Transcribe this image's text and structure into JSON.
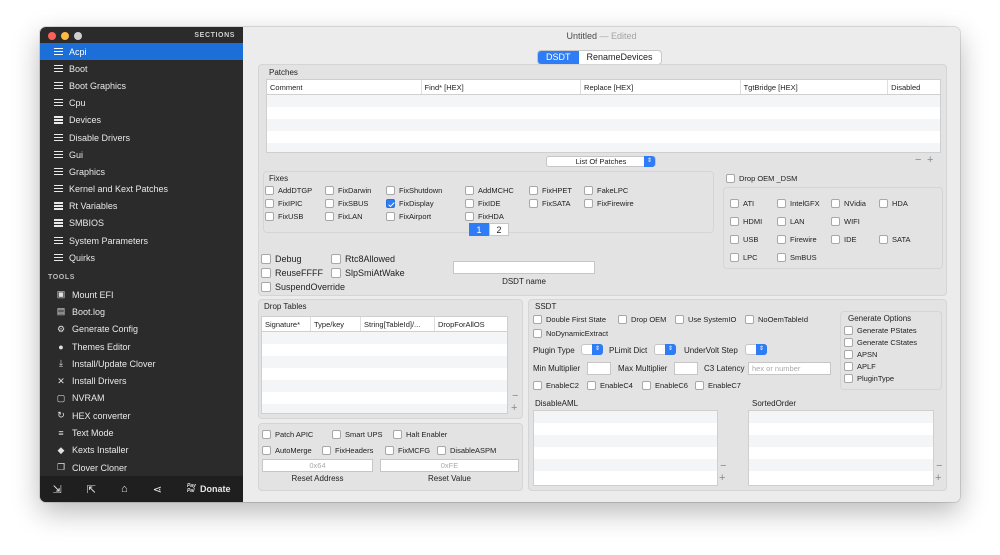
{
  "window": {
    "title": "Untitled",
    "edited": "— Edited"
  },
  "sidebar": {
    "sections_header": "SECTIONS",
    "items": [
      {
        "label": "Acpi",
        "active": true
      },
      {
        "label": "Boot"
      },
      {
        "label": "Boot Graphics"
      },
      {
        "label": "Cpu"
      },
      {
        "label": "Devices"
      },
      {
        "label": "Disable Drivers"
      },
      {
        "label": "Gui"
      },
      {
        "label": "Graphics"
      },
      {
        "label": "Kernel and Kext Patches"
      },
      {
        "label": "Rt Variables"
      },
      {
        "label": "SMBIOS"
      },
      {
        "label": "System Parameters"
      },
      {
        "label": "Quirks"
      }
    ],
    "tools_header": "TOOLS",
    "tools": [
      {
        "label": "Mount EFI",
        "icon": "disk-icon"
      },
      {
        "label": "Boot.log",
        "icon": "log-icon"
      },
      {
        "label": "Generate Config",
        "icon": "gears-icon"
      },
      {
        "label": "Themes Editor",
        "icon": "palette-icon"
      },
      {
        "label": "Install/Update Clover",
        "icon": "download-icon"
      },
      {
        "label": "Install Drivers",
        "icon": "tools-icon"
      },
      {
        "label": "NVRAM",
        "icon": "chip-icon"
      },
      {
        "label": "HEX converter",
        "icon": "refresh-icon"
      },
      {
        "label": "Text Mode",
        "icon": "text-icon"
      },
      {
        "label": "Kexts Installer",
        "icon": "kext-icon"
      },
      {
        "label": "Clover Cloner",
        "icon": "clone-icon"
      }
    ],
    "bottom": {
      "pay_top": "Pay",
      "pay_bottom": "Pal",
      "donate": "Donate"
    }
  },
  "tabs": {
    "dsdt": "DSDT",
    "rename": "RenameDevices"
  },
  "patches": {
    "label": "Patches",
    "columns": [
      "Comment",
      "Find* [HEX]",
      "Replace [HEX]",
      "TgtBridge [HEX]",
      "Disabled"
    ],
    "list_popup": "List Of Patches"
  },
  "fixes": {
    "label": "Fixes",
    "items": [
      {
        "label": "AddDTGP",
        "checked": false
      },
      {
        "label": "FixDarwin",
        "checked": false
      },
      {
        "label": "FixShutdown",
        "checked": false
      },
      {
        "label": "AddMCHC",
        "checked": false
      },
      {
        "label": "FixHPET",
        "checked": false
      },
      {
        "label": "FakeLPC",
        "checked": false
      },
      {
        "label": "FixIPIC",
        "checked": false
      },
      {
        "label": "FixSBUS",
        "checked": false
      },
      {
        "label": "FixDisplay",
        "checked": true
      },
      {
        "label": "FixIDE",
        "checked": false
      },
      {
        "label": "FixSATA",
        "checked": false
      },
      {
        "label": "FixFirewire",
        "checked": false
      },
      {
        "label": "FixUSB",
        "checked": false
      },
      {
        "label": "FixLAN",
        "checked": false
      },
      {
        "label": "FixAirport",
        "checked": false
      },
      {
        "label": "FixHDA",
        "checked": false
      }
    ],
    "pages": [
      "1",
      "2"
    ]
  },
  "drop_oem_dsm": {
    "label": "Drop OEM _DSM",
    "items": [
      "ATI",
      "IntelGFX",
      "NVidia",
      "HDA",
      "HDMI",
      "LAN",
      "WIFI",
      "USB",
      "Firewire",
      "IDE",
      "SATA",
      "LPC",
      "SmBUS"
    ]
  },
  "misc": {
    "debug": "Debug",
    "rtc": "Rtc8Allowed",
    "reuse": "ReuseFFFF",
    "slp": "SlpSmiAtWake",
    "suspend": "SuspendOverride",
    "dsdt_name": "DSDT name"
  },
  "drop_tables": {
    "label": "Drop Tables",
    "columns": [
      "Signature*",
      "Type/key",
      "String[TableId]/...",
      "DropForAllOS"
    ]
  },
  "bottom_checks": [
    "Patch APIC",
    "Smart UPS",
    "Halt Enabler",
    "AutoMerge",
    "FixHeaders",
    "FixMCFG",
    "DisableASPM"
  ],
  "reset": {
    "address_placeholder": "0x64",
    "value_placeholder": "0xFE",
    "address_label": "Reset Address",
    "value_label": "Reset Value"
  },
  "ssdt": {
    "label": "SSDT",
    "checks": [
      "Double First State",
      "Drop OEM",
      "Use SystemIO",
      "NoOemTableId",
      "NoDynamicExtract"
    ],
    "plugin_type": "Plugin Type",
    "plimit": "PLimit Dict",
    "undervolt": "UnderVolt Step",
    "min_mult": "Min Multiplier",
    "max_mult": "Max Multiplier",
    "c3": "C3 Latency",
    "c3_placeholder": "hex or number",
    "cstates": [
      "EnableC2",
      "EnableC4",
      "EnableC6",
      "EnableC7"
    ],
    "generate_options": {
      "label": "Generate Options",
      "items": [
        "Generate PStates",
        "Generate CStates",
        "APSN",
        "APLF",
        "PluginType"
      ]
    }
  },
  "disable_aml": {
    "label": "DisableAML"
  },
  "sorted_order": {
    "label": "SortedOrder"
  },
  "colors": {
    "accent": "#2e7cf6",
    "sidebar_bg": "#2b2b2b",
    "selected": "#1c6fd8",
    "close": "#fc605b",
    "minimize": "#fdbc40",
    "zoom": "#cfcfcf"
  }
}
